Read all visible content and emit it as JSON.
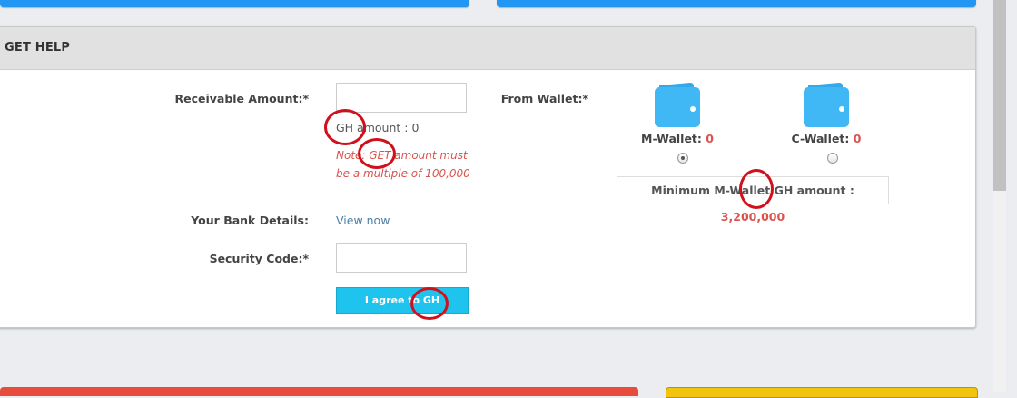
{
  "panel": {
    "title": "GET HELP"
  },
  "form": {
    "receivable_label": "Receivable Amount:*",
    "receivable_value": "",
    "gh_amount_text": "GH amount : 0",
    "note_text": "Note: GET amount must be a multiple of 100,000",
    "bank_label": "Your Bank Details:",
    "bank_link": "View now",
    "security_label": "Security Code:*",
    "security_value": "",
    "agree_button": "I agree to GH"
  },
  "wallet": {
    "label": "From Wallet:*",
    "options": [
      {
        "name": "M-Wallet:",
        "value": "0",
        "selected": true
      },
      {
        "name": "C-Wallet:",
        "value": "0",
        "selected": false
      }
    ],
    "minimum_label": "Minimum M-Wallet GH amount :",
    "minimum_value": "3,200,000"
  },
  "colors": {
    "top_bar": "#2196f3",
    "accent_button": "#1ec4ee",
    "highlight_red": "#d9534f",
    "annotation_circle": "#d0111c"
  }
}
